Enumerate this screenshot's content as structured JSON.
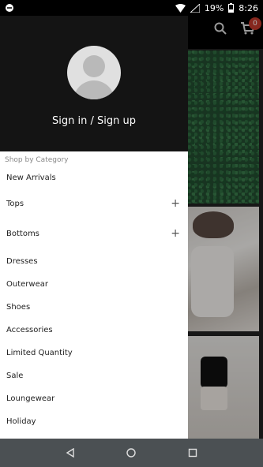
{
  "status_bar": {
    "battery": "19%",
    "time": "8:26"
  },
  "app": {
    "cart_count": "0"
  },
  "drawer": {
    "signin_label": "Sign in / Sign up",
    "section_label": "Shop by Category",
    "items": [
      {
        "label": "New Arrivals"
      },
      {
        "label": "Tops",
        "expand": "+"
      },
      {
        "label": "Bottoms",
        "expand": "+"
      },
      {
        "label": "Dresses"
      },
      {
        "label": "Outerwear"
      },
      {
        "label": "Shoes"
      },
      {
        "label": "Accessories"
      },
      {
        "label": "Limited Quantity"
      },
      {
        "label": "Sale"
      },
      {
        "label": "Loungewear"
      },
      {
        "label": "Holiday"
      }
    ]
  },
  "colors": {
    "cart_badge": "#c0392b",
    "drawer_header": "#141414",
    "nav_bar": "#4b5053"
  }
}
